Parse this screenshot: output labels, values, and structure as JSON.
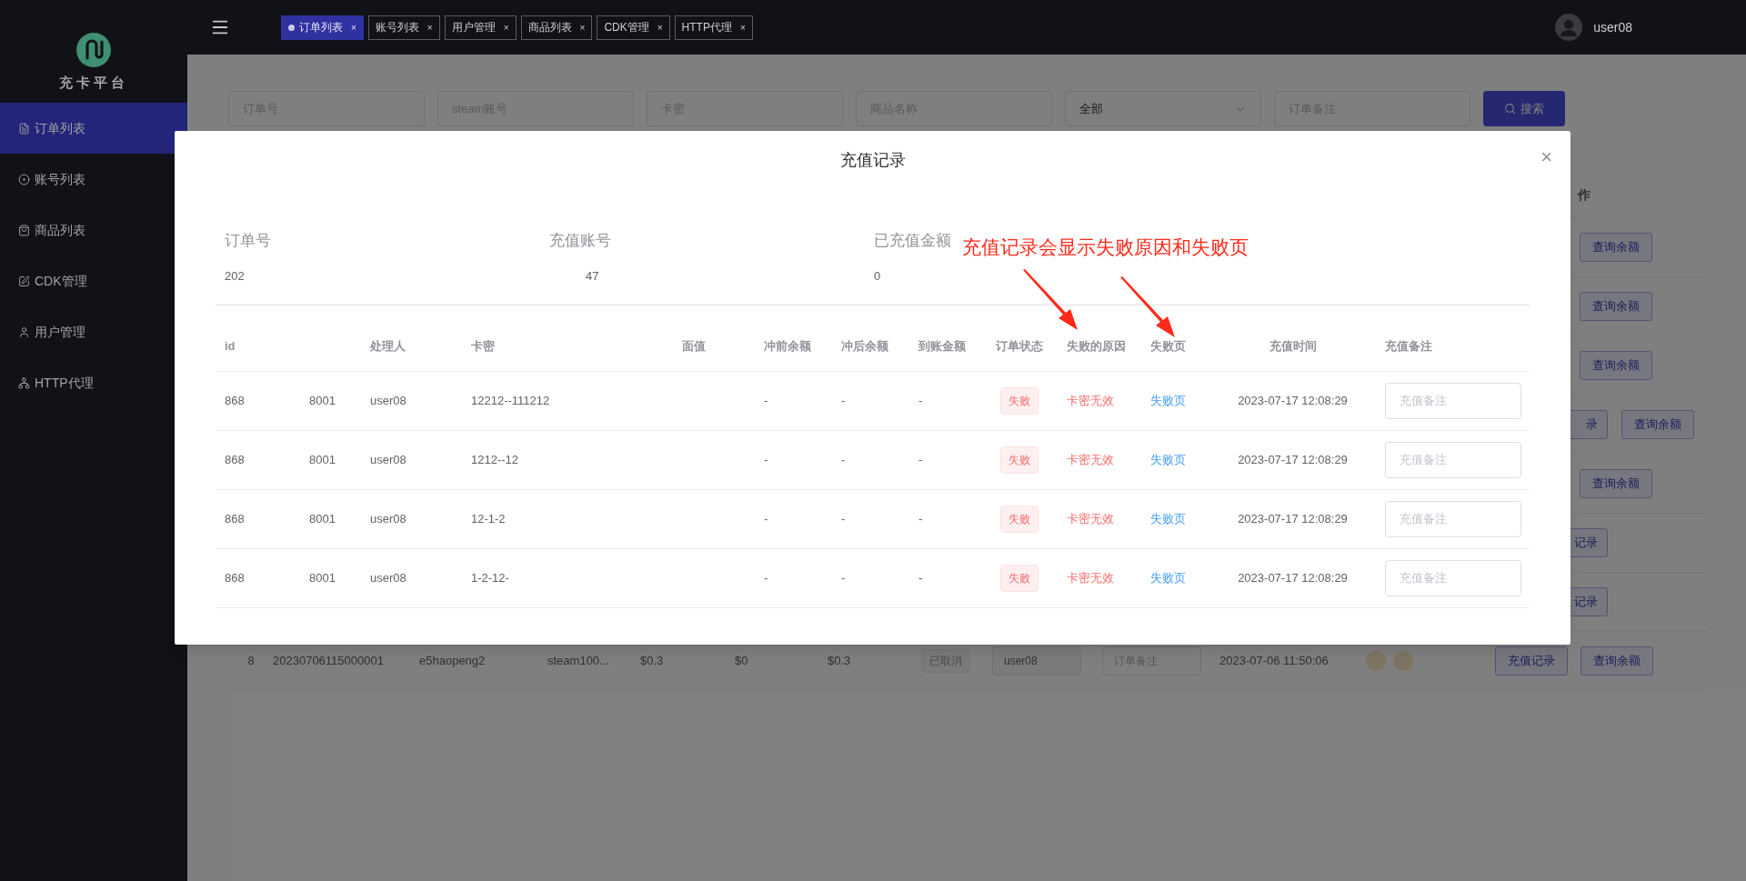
{
  "sidebar": {
    "logo_text": "充卡平台",
    "items": [
      {
        "label": "订单列表",
        "selected": true
      },
      {
        "label": "账号列表",
        "selected": false
      },
      {
        "label": "商品列表",
        "selected": false
      },
      {
        "label": "CDK管理",
        "selected": false
      },
      {
        "label": "用户管理",
        "selected": false
      },
      {
        "label": "HTTP代理",
        "selected": false
      }
    ]
  },
  "topbar": {
    "tabs": [
      {
        "label": "订单列表",
        "selected": true,
        "close": "×"
      },
      {
        "label": "账号列表",
        "selected": false,
        "close": "×"
      },
      {
        "label": "用户管理",
        "selected": false,
        "close": "×"
      },
      {
        "label": "商品列表",
        "selected": false,
        "close": "×"
      },
      {
        "label": "CDK管理",
        "selected": false,
        "close": "×"
      },
      {
        "label": "HTTP代理",
        "selected": false,
        "close": "×"
      }
    ],
    "user": "user08"
  },
  "filters": [
    {
      "kind": "input",
      "placeholder": "订单号"
    },
    {
      "kind": "input",
      "placeholder": "steam账号"
    },
    {
      "kind": "input",
      "placeholder": "卡密"
    },
    {
      "kind": "input",
      "placeholder": "商品名称"
    },
    {
      "kind": "select",
      "value": "全部"
    },
    {
      "kind": "input",
      "placeholder": "订单备注"
    },
    {
      "kind": "button",
      "label": "搜索"
    }
  ],
  "orders": {
    "header": "作",
    "rows": [
      {
        "kind": "ops",
        "buttons": [
          {
            "label": "查询余额",
            "partial": false
          }
        ]
      },
      {
        "kind": "ops",
        "buttons": [
          {
            "label": "查询余额",
            "partial": false
          }
        ]
      },
      {
        "kind": "ops",
        "buttons": [
          {
            "label": "查询余额",
            "partial": false
          }
        ]
      },
      {
        "kind": "ops",
        "buttons": [
          {
            "label": "录",
            "partial": true
          },
          {
            "label": "查询余额",
            "partial": false
          }
        ]
      },
      {
        "kind": "ops",
        "buttons": [
          {
            "label": "查询余额",
            "partial": false
          }
        ]
      },
      {
        "kind": "ops",
        "buttons": [
          {
            "label": "记录",
            "partial": true
          }
        ]
      },
      {
        "kind": "ops",
        "buttons": [
          {
            "label": "记录",
            "partial": true
          }
        ]
      },
      {
        "kind": "full",
        "index": "8",
        "order_no": "20230706115000001",
        "account": "e5haopeng2",
        "card": "steam100...",
        "price": "$0.3",
        "balance_before": "$0",
        "balance_after": "$0.3",
        "status": "已取消",
        "handler": "user08",
        "note_placeholder": "订单备注",
        "time": "2023-07-06 11:50:06",
        "buttons": [
          {
            "label": "充值记录",
            "partial": false
          },
          {
            "label": "查询余额",
            "partial": false
          }
        ]
      }
    ]
  },
  "modal": {
    "title": "充值记录",
    "close": "×",
    "info": [
      {
        "label": "订单号",
        "value": "202"
      },
      {
        "label": "充值账号",
        "value": "47"
      },
      {
        "label": "已充值金额",
        "value": "0"
      }
    ],
    "annotation": "充值记录会显示失败原因和失败页",
    "columns": [
      {
        "label": "id"
      },
      {
        "label": "处理人"
      },
      {
        "label": "卡密"
      },
      {
        "label": "面值"
      },
      {
        "label": "冲前余额"
      },
      {
        "label": "冲后余额"
      },
      {
        "label": "到账金额"
      },
      {
        "label": "订单状态"
      },
      {
        "label": "失败的原因"
      },
      {
        "label": "失败页"
      },
      {
        "label": "充值时间"
      },
      {
        "label": "充值备注"
      }
    ],
    "rows": [
      {
        "id": "868",
        "column_2": "8001",
        "handler": "user08",
        "card": "12212--111212",
        "before": "-",
        "after": "-",
        "credited": "-",
        "status": "失败",
        "reason": "卡密无效",
        "fail_page": "失败页",
        "time": "2023-07-17 12:08:29",
        "note_placeholder": "充值备注"
      },
      {
        "id": "868",
        "column_2": "8001",
        "handler": "user08",
        "card": "1212--12",
        "before": "-",
        "after": "-",
        "credited": "-",
        "status": "失败",
        "reason": "卡密无效",
        "fail_page": "失败页",
        "time": "2023-07-17 12:08:29",
        "note_placeholder": "充值备注"
      },
      {
        "id": "868",
        "column_2": "8001",
        "handler": "user08",
        "card": "12-1-2",
        "before": "-",
        "after": "-",
        "credited": "-",
        "status": "失败",
        "reason": "卡密无效",
        "fail_page": "失败页",
        "time": "2023-07-17 12:08:29",
        "note_placeholder": "充值备注"
      },
      {
        "id": "868",
        "column_2": "8001",
        "handler": "user08",
        "card": "1-2-12-",
        "before": "-",
        "after": "-",
        "credited": "-",
        "status": "失败",
        "reason": "卡密无效",
        "fail_page": "失败页",
        "time": "2023-07-17 12:08:29",
        "note_placeholder": "充值备注"
      }
    ]
  }
}
